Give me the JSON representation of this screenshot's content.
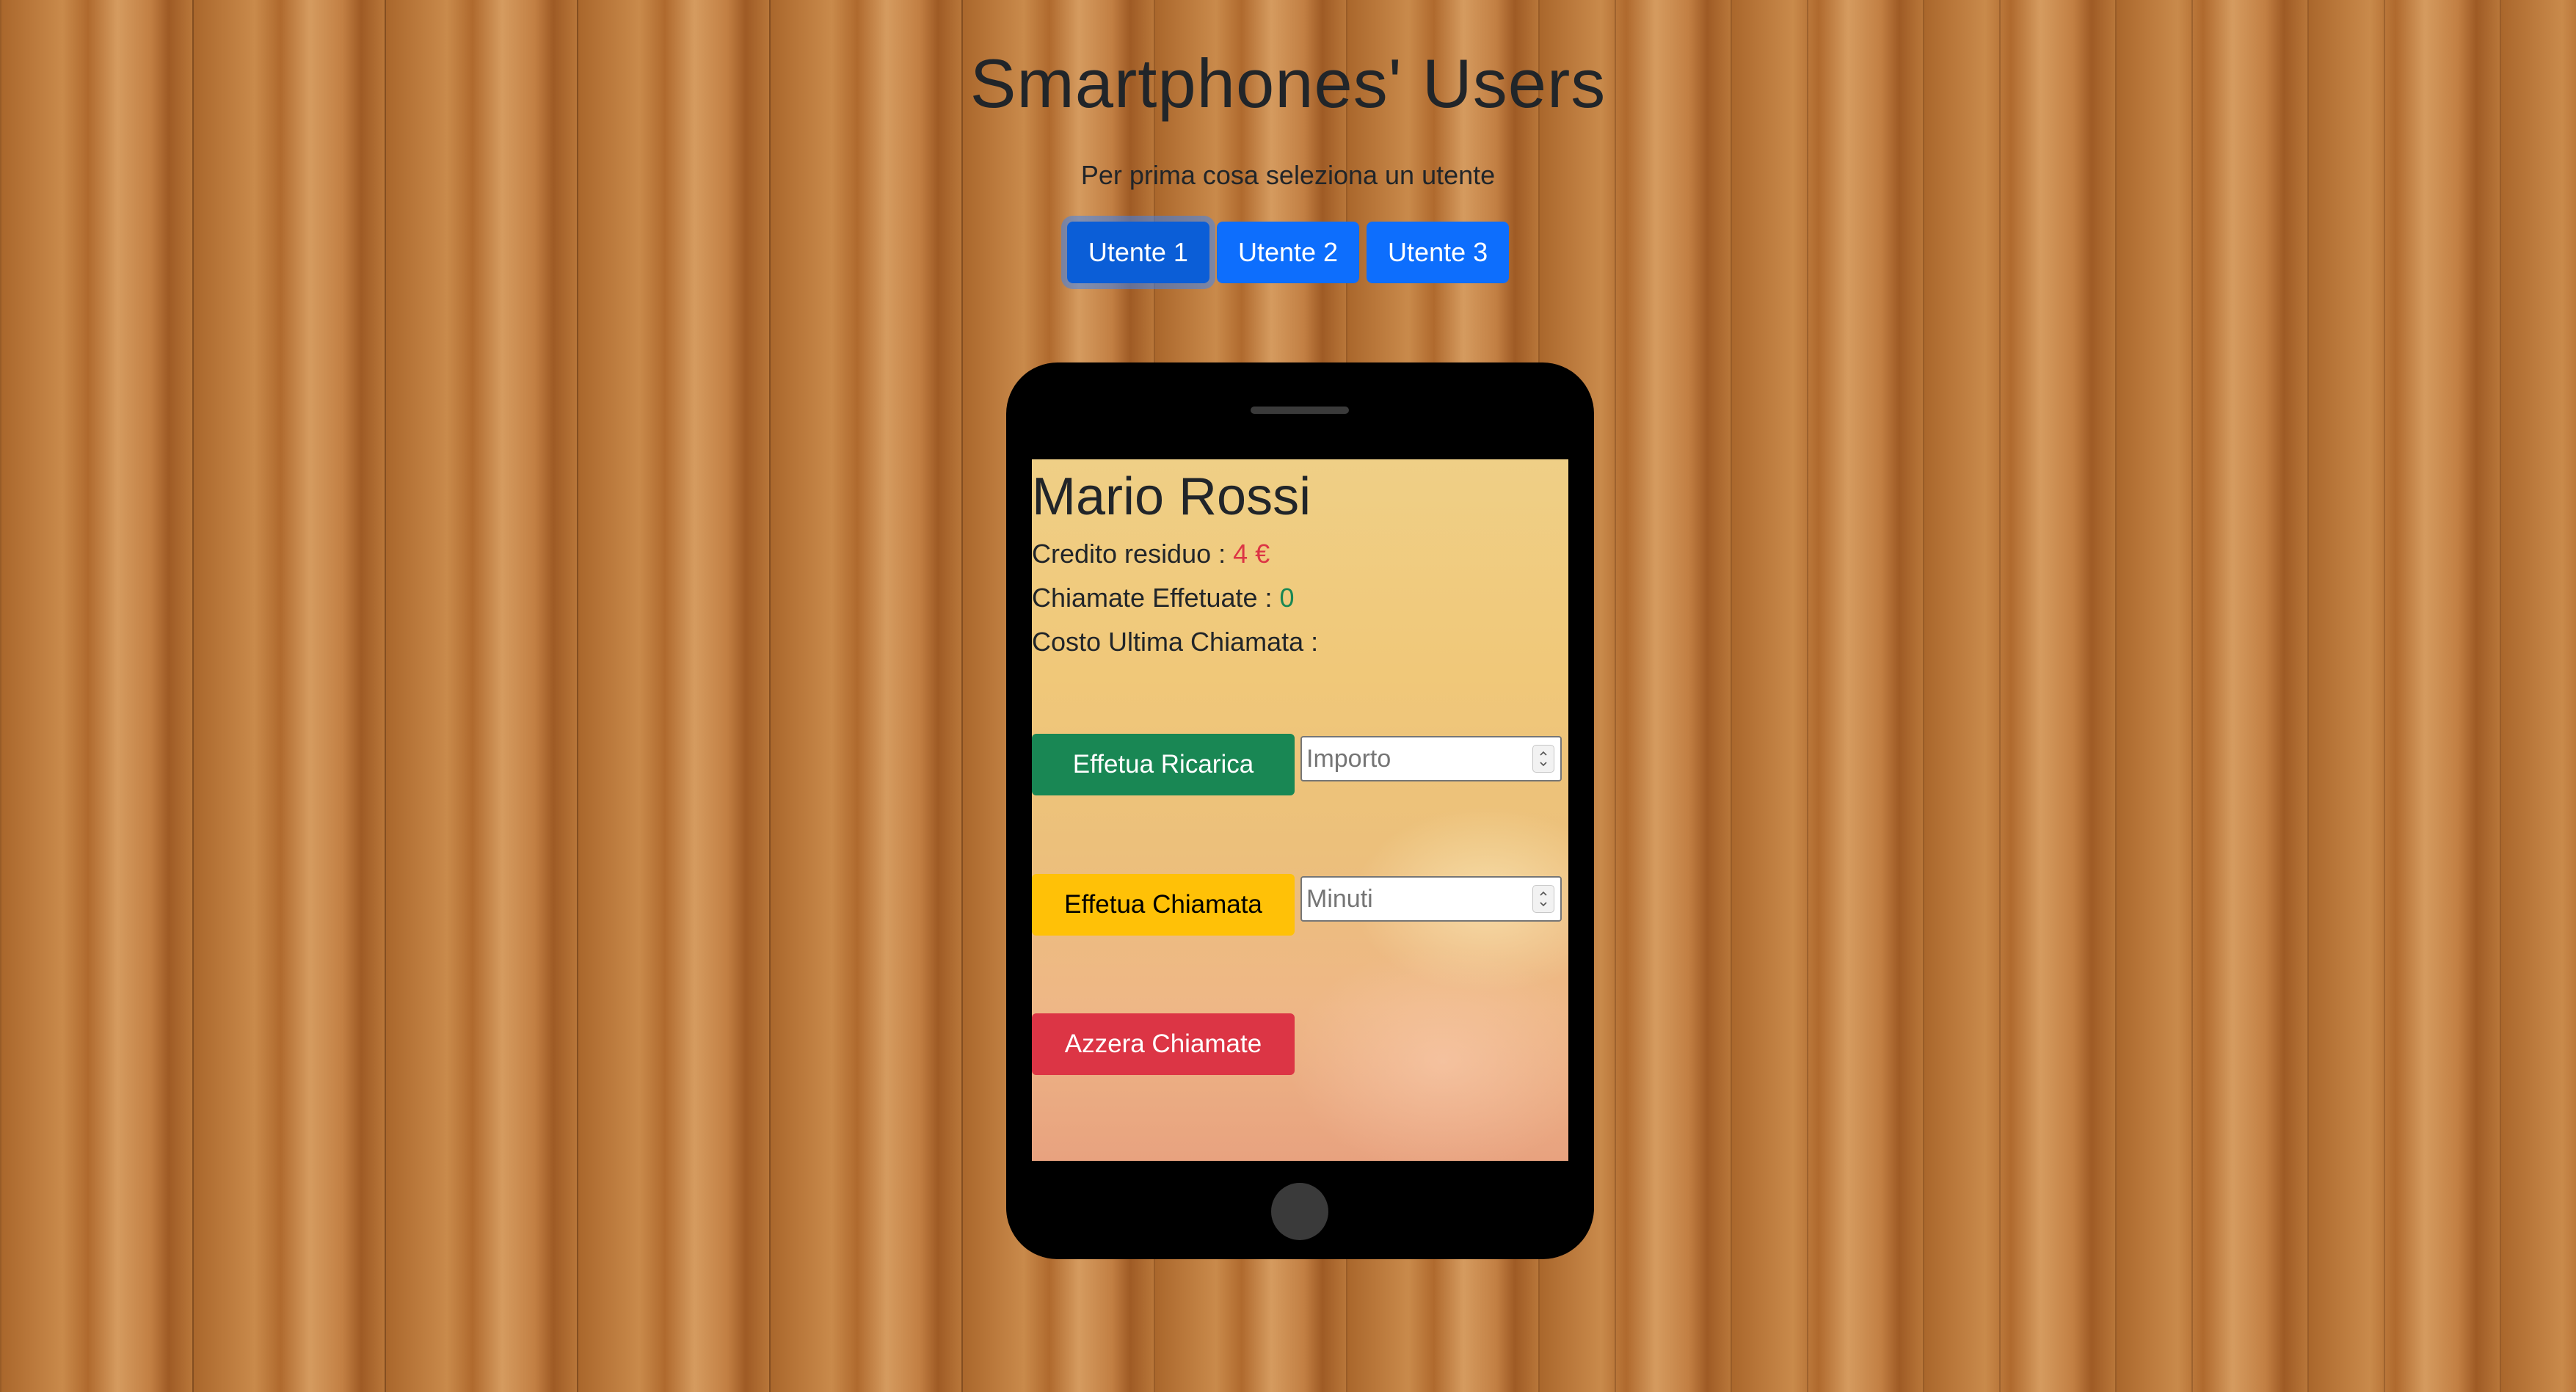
{
  "header": {
    "title": "Smartphones' Users",
    "subtitle": "Per prima cosa seleziona un utente"
  },
  "user_selector": {
    "active_index": 0,
    "buttons": [
      {
        "label": "Utente 1"
      },
      {
        "label": "Utente 2"
      },
      {
        "label": "Utente 3"
      }
    ]
  },
  "phone": {
    "user_name": "Mario Rossi",
    "credit": {
      "label": "Credito residuo : ",
      "value": "4 €",
      "color": "#dc3545"
    },
    "calls": {
      "label": "Chiamate Effetuate : ",
      "value": "0",
      "color": "#198754"
    },
    "last_call_cost": {
      "label": "Costo Ultima Chiamata : ",
      "value": ""
    },
    "recharge": {
      "button_label": "Effetua Ricarica",
      "placeholder": "Importo",
      "value": ""
    },
    "call": {
      "button_label": "Effetua Chiamata",
      "placeholder": "Minuti",
      "value": ""
    },
    "reset": {
      "button_label": "Azzera Chiamate"
    }
  },
  "colors": {
    "primary": "#0d6efd",
    "success": "#198754",
    "warning": "#ffc107",
    "danger": "#dc3545"
  },
  "icons": {
    "spinner_up": "chevron-up-icon",
    "spinner_down": "chevron-down-icon"
  }
}
